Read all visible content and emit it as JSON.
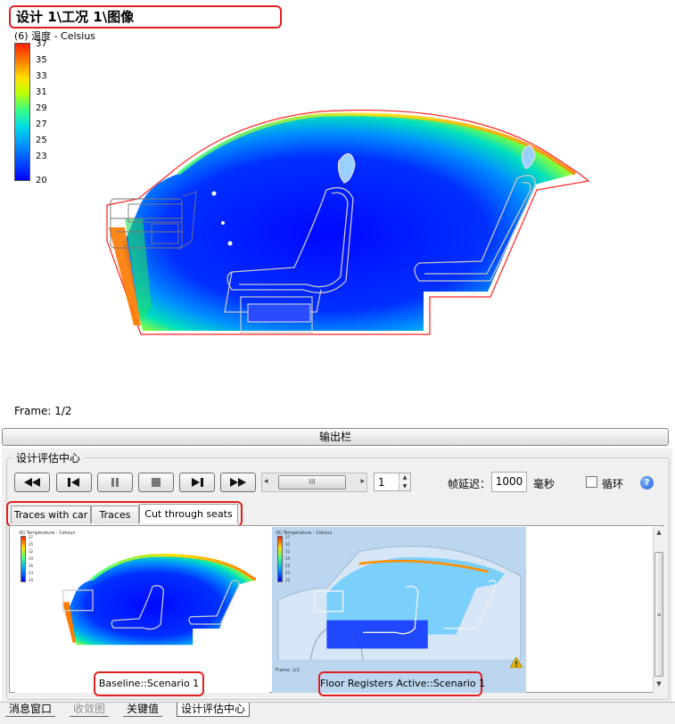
{
  "viewport": {
    "title": "设计 1\\工况 1\\图像",
    "legend_title": "(6) 温度 - Celsius",
    "legend_ticks": [
      "37",
      "35",
      "33",
      "31",
      "29",
      "27",
      "25",
      "23",
      "20"
    ],
    "frame": "Frame: 1/2"
  },
  "output_bar": {
    "label": "输出栏"
  },
  "panel": {
    "group_title": "设计评估中心",
    "playback": {
      "buttons": [
        "rewind",
        "step-back",
        "pause",
        "stop",
        "step-forward",
        "fast-forward"
      ],
      "slider_left": "◂",
      "slider_right": "▸",
      "slider_thumb": "III",
      "frame_value": "1",
      "spin_up": "▲",
      "spin_down": "▼",
      "delay_label": "帧延迟：",
      "delay_value": "1000",
      "delay_unit": "毫秒",
      "loop_label": "循环",
      "loop_checked": false,
      "help": "?"
    },
    "tabs": [
      {
        "label": "Traces with car",
        "active": false
      },
      {
        "label": "Traces",
        "active": false
      },
      {
        "label": "Cut through seats",
        "active": true
      }
    ],
    "thumbnails": [
      {
        "label": "Baseline::Scenario 1",
        "legend_title": "(6) Temperature - Celsius",
        "legend_ticks": [
          "37",
          "35",
          "32",
          "29",
          "26",
          "23",
          "20"
        ]
      },
      {
        "label": "Floor Registers Active::Scenario 1",
        "legend_title": "(6) Temperature - Celsius",
        "legend_ticks": [
          "37",
          "35",
          "32",
          "29",
          "26",
          "23",
          "20"
        ],
        "frame": "Frame: 2/2"
      }
    ],
    "scroll": {
      "up": "▲",
      "down": "▼",
      "grip": "≡"
    }
  },
  "bottom_tabs": [
    {
      "label": "消息窗口",
      "state": "normal"
    },
    {
      "label": "收敛图",
      "state": "disabled"
    },
    {
      "label": "关键值",
      "state": "normal"
    },
    {
      "label": "设计评估中心",
      "state": "active"
    }
  ],
  "colors": {
    "highlight": "#e02020",
    "temp_low": "#0000ff",
    "temp_high": "#ff2000",
    "thumb2_bg": "#bcd6f0"
  }
}
